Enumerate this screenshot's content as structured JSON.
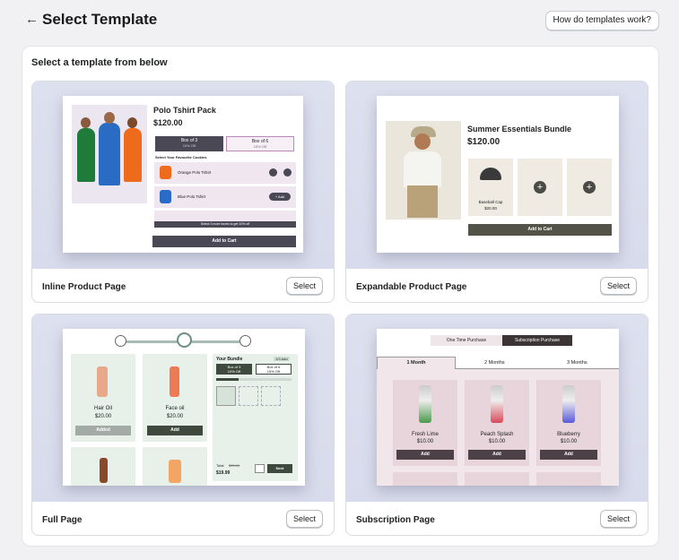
{
  "header": {
    "back_icon": "arrow-left-icon",
    "title": "Select Template",
    "help_label": "How do templates work?"
  },
  "panel": {
    "subtitle": "Select a template from below"
  },
  "select_label": "Select",
  "cards": [
    {
      "name": "Inline Product Page",
      "preview": {
        "title": "Polo Tshirt Pack",
        "price": "$120.00",
        "tab1": "Box of 3",
        "tab1_sub": "10% Off",
        "tab2": "Box of 6",
        "tab2_sub": "15% Off",
        "select_text": "Select Your Favourite Cookies",
        "item1": "Orange Polo Tshirt",
        "item2": "Blue Polo Tshirt",
        "item2_btn": "+ Add",
        "footer_note": "Select 3 more boxes to get 10% off",
        "cart": "Add to Cart"
      }
    },
    {
      "name": "Expandable Product Page",
      "preview": {
        "title": "Summer Essentials Bundle",
        "price": "$120.00",
        "item": "Baseball Cap",
        "item_price": "$20.00",
        "cart": "Add to Cart"
      }
    },
    {
      "name": "Full Page",
      "preview": {
        "p1": "Hair Oil",
        "p1_price": "$20.00",
        "p1_btn": "Added",
        "p2": "Face oil",
        "p2_price": "$20.00",
        "p2_btn": "Add",
        "bundle": "Your Bundle",
        "bundle_badge": "1/3 Add",
        "box1": "Box of 3",
        "box1_sub": "10% Off",
        "box2": "Box of 6",
        "box2_sub": "15% Off",
        "total_label": "Total",
        "total_old": "$25.00",
        "total": "$19.99",
        "next": "Next"
      }
    },
    {
      "name": "Subscription Page",
      "preview": {
        "tab_one": "One Time Purchase",
        "tab_sub": "Subscription Purchase",
        "m1": "1 Month",
        "m2": "2 Months",
        "m3": "3 Months",
        "c1": "Fresh Lime",
        "c1_price": "$10.00",
        "c2": "Peach Splash",
        "c2_price": "$10.00",
        "c3": "Blueberry",
        "c3_price": "$10.00",
        "add": "Add"
      }
    }
  ],
  "colors": {
    "dark_btn": "#4b4856",
    "lavender": "#efe6ef",
    "pink": "#f1e6ea",
    "green_panel": "#e8f0ea"
  }
}
